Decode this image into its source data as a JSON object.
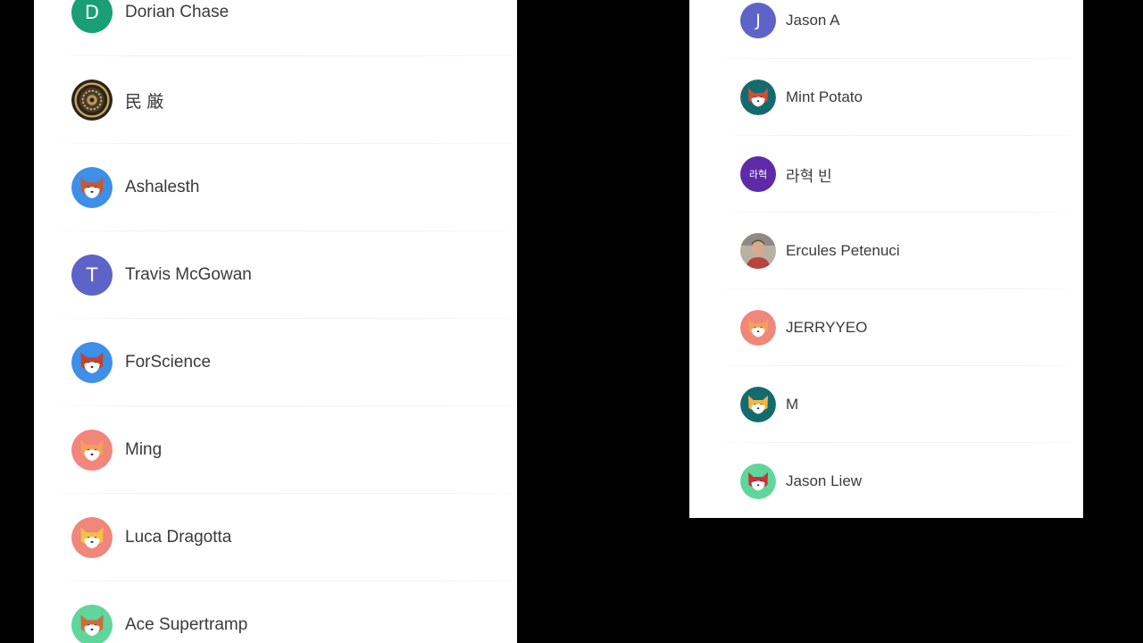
{
  "left_list": [
    {
      "name": "Dorian Chase",
      "avatar": {
        "type": "letter",
        "letter": "D",
        "bg": "#1a9e74"
      }
    },
    {
      "name": "民 厳",
      "avatar": {
        "type": "ornate"
      }
    },
    {
      "name": "Ashalesth",
      "avatar": {
        "type": "fox",
        "bg": "#3d8fe8",
        "head": "#c45a33"
      }
    },
    {
      "name": "Travis McGowan",
      "avatar": {
        "type": "letter",
        "letter": "T",
        "bg": "#5e63c9"
      }
    },
    {
      "name": "ForScience",
      "avatar": {
        "type": "fox",
        "bg": "#3d8fe8",
        "head": "#c4432f"
      }
    },
    {
      "name": "Ming",
      "avatar": {
        "type": "fox",
        "bg": "#f1867b",
        "head": "#f2a05a"
      }
    },
    {
      "name": "Luca Dragotta",
      "avatar": {
        "type": "fox",
        "bg": "#f1867b",
        "head": "#f5c142"
      }
    },
    {
      "name": "Ace Supertramp",
      "avatar": {
        "type": "fox",
        "bg": "#5fd69a",
        "head": "#d06a3a"
      }
    }
  ],
  "right_list": [
    {
      "name": "Jason A",
      "avatar": {
        "type": "letter",
        "letter": "J",
        "bg": "#5e63c9"
      }
    },
    {
      "name": "Mint Potato",
      "avatar": {
        "type": "fox",
        "bg": "#146b6e",
        "head": "#d5493a"
      }
    },
    {
      "name": "라혁 빈",
      "avatar": {
        "type": "letter",
        "letter": "라혁",
        "bg": "#5e2aa8"
      }
    },
    {
      "name": "Ercules Petenuci",
      "avatar": {
        "type": "photo"
      }
    },
    {
      "name": "JERRYYEO",
      "avatar": {
        "type": "fox",
        "bg": "#f1867b",
        "head": "#f2a05a"
      }
    },
    {
      "name": "M",
      "avatar": {
        "type": "fox",
        "bg": "#146b6e",
        "head": "#f5b542"
      }
    },
    {
      "name": "Jason Liew",
      "avatar": {
        "type": "fox",
        "bg": "#5fd69a",
        "head": "#c8323c"
      }
    }
  ]
}
